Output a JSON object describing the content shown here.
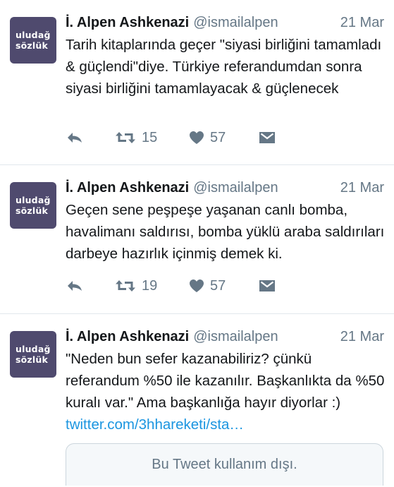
{
  "tweets": [
    {
      "avatar": {
        "line1": "uludağ",
        "line2": "sözlük"
      },
      "name": "İ. Alpen Ashkenazi",
      "handle": "@ismailalpen",
      "date": "21 Mar",
      "text": "Tarih kitaplarında geçer \"siyasi birliğini tamamladı & güçlendi\"diye. Türkiye referandumdan sonra siyasi birliğini tamamlayacak & güçlenecek",
      "retweets": "15",
      "likes": "57"
    },
    {
      "avatar": {
        "line1": "uludağ",
        "line2": "sözlük"
      },
      "name": "İ. Alpen Ashkenazi",
      "handle": "@ismailalpen",
      "date": "21 Mar",
      "text": "Geçen sene peşpeşe yaşanan canlı bomba, havalimanı saldırısı, bomba yüklü araba saldırıları darbeye hazırlık içinmiş demek ki.",
      "retweets": "19",
      "likes": "57"
    },
    {
      "avatar": {
        "line1": "uludağ",
        "line2": "sözlük"
      },
      "name": "İ. Alpen Ashkenazi",
      "handle": "@ismailalpen",
      "date": "21 Mar",
      "text": "\"Neden bun sefer kazanabiliriz? çünkü referandum %50 ile kazanılır. Başkanlıkta da %50 kuralı var.\" Ama başkanlığa hayır diyorlar :)",
      "link": "twitter.com/3hhareketi/sta…",
      "card_text": "Bu Tweet kullanım dışı."
    }
  ],
  "icons": {
    "reply": "reply-icon",
    "retweet": "retweet-icon",
    "like": "heart-icon",
    "dm": "envelope-icon"
  },
  "colors": {
    "avatar_bg": "#4f4a6e",
    "link": "#1b95e0",
    "muted": "#657786"
  }
}
